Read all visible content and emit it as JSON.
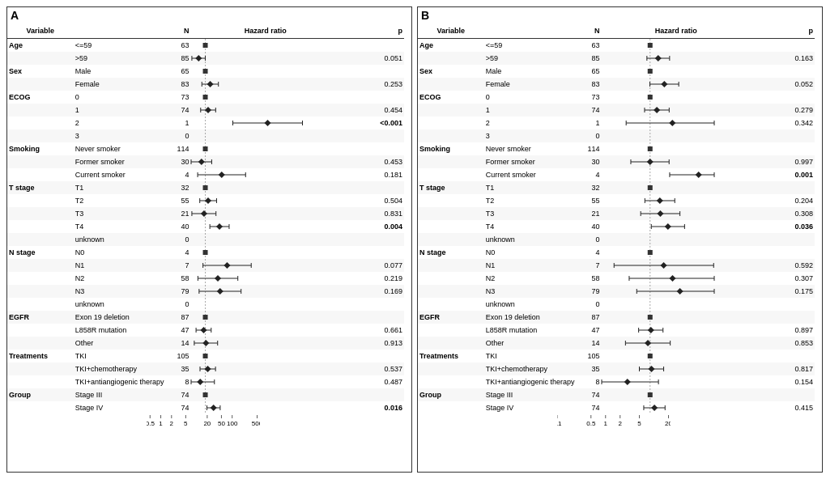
{
  "panels": {
    "A": {
      "label": "A",
      "rows": [
        {
          "variable": "Age",
          "subvar": "<=59",
          "n": "63",
          "hr_text": "Reference",
          "p": ""
        },
        {
          "variable": "",
          "subvar": ">59",
          "n": "85",
          "hr_text": "0.65 (0.42, 1.00)",
          "p": "0.051",
          "hr": 0.65,
          "lo": 0.42,
          "hi": 1.0
        },
        {
          "variable": "Sex",
          "subvar": "Male",
          "n": "65",
          "hr_text": "Reference",
          "p": ""
        },
        {
          "variable": "",
          "subvar": "Female",
          "n": "83",
          "hr_text": "1.37 (0.80, 2.33)",
          "p": "0.253",
          "hr": 1.37,
          "lo": 0.8,
          "hi": 2.33
        },
        {
          "variable": "ECOG",
          "subvar": "0",
          "n": "73",
          "hr_text": "Reference",
          "p": ""
        },
        {
          "variable": "",
          "subvar": "1",
          "n": "74",
          "hr_text": "1.20 (0.74, 1.95)",
          "p": "0.454",
          "hr": 1.2,
          "lo": 0.74,
          "hi": 1.95
        },
        {
          "variable": "",
          "subvar": "2",
          "n": "1",
          "hr_text": "55.65 (5.89, 526.12)",
          "p": "<0.001",
          "hr": 55.65,
          "lo": 5.89,
          "hi": 526.12,
          "extreme": true
        },
        {
          "variable": "",
          "subvar": "3",
          "n": "0",
          "hr_text": "",
          "p": ""
        },
        {
          "variable": "Smoking",
          "subvar": "Never smoker",
          "n": "114",
          "hr_text": "Reference",
          "p": ""
        },
        {
          "variable": "",
          "subvar": "Former smoker",
          "n": "30",
          "hr_text": "0.78 (0.40, 1.51)",
          "p": "0.453",
          "hr": 0.78,
          "lo": 0.4,
          "hi": 1.51
        },
        {
          "variable": "",
          "subvar": "Current smoker",
          "n": "4",
          "hr_text": "2.87 (0.61, 13.43)",
          "p": "0.181",
          "hr": 2.87,
          "lo": 0.61,
          "hi": 13.43
        },
        {
          "variable": "T stage",
          "subvar": "T1",
          "n": "32",
          "hr_text": "Reference",
          "p": ""
        },
        {
          "variable": "",
          "subvar": "T2",
          "n": "55",
          "hr_text": "1.20 (0.70, 2.07)",
          "p": "0.504",
          "hr": 1.2,
          "lo": 0.7,
          "hi": 2.07
        },
        {
          "variable": "",
          "subvar": "T3",
          "n": "21",
          "hr_text": "0.92 (0.42, 1.99)",
          "p": "0.831",
          "hr": 0.92,
          "lo": 0.42,
          "hi": 1.99
        },
        {
          "variable": "",
          "subvar": "T4",
          "n": "40",
          "hr_text": "2.49 (1.34, 4.65)",
          "p": "0.004",
          "hr": 2.49,
          "lo": 1.34,
          "hi": 4.65
        },
        {
          "variable": "",
          "subvar": "unknown",
          "n": "0",
          "hr_text": "",
          "p": ""
        },
        {
          "variable": "N stage",
          "subvar": "N0",
          "n": "4",
          "hr_text": "Reference",
          "p": ""
        },
        {
          "variable": "",
          "subvar": "N1",
          "n": "7",
          "hr_text": "4.07 (0.86, 19.32)",
          "p": "0.077",
          "hr": 4.07,
          "lo": 0.86,
          "hi": 19.32
        },
        {
          "variable": "",
          "subvar": "N2",
          "n": "58",
          "hr_text": "2.24 (0.62, 8.15)",
          "p": "0.219",
          "hr": 2.24,
          "lo": 0.62,
          "hi": 8.15
        },
        {
          "variable": "",
          "subvar": "N3",
          "n": "79",
          "hr_text": "2.59 (0.67, 10.05)",
          "p": "0.169",
          "hr": 2.59,
          "lo": 0.67,
          "hi": 10.05
        },
        {
          "variable": "",
          "subvar": "unknown",
          "n": "0",
          "hr_text": "",
          "p": ""
        },
        {
          "variable": "EGFR",
          "subvar": "Exon 19 deletion",
          "n": "87",
          "hr_text": "Reference",
          "p": ""
        },
        {
          "variable": "",
          "subvar": "L858R mutation",
          "n": "47",
          "hr_text": "0.90 (0.55, 1.46)",
          "p": "0.661",
          "hr": 0.9,
          "lo": 0.55,
          "hi": 1.46
        },
        {
          "variable": "",
          "subvar": "Other",
          "n": "14",
          "hr_text": "1.04 (0.49, 2.21)",
          "p": "0.913",
          "hr": 1.04,
          "lo": 0.49,
          "hi": 2.21
        },
        {
          "variable": "Treatments",
          "subvar": "TKI",
          "n": "105",
          "hr_text": "Reference",
          "p": ""
        },
        {
          "variable": "",
          "subvar": "TKI+chemotherapy",
          "n": "35",
          "hr_text": "1.17 (0.71, 1.93)",
          "p": "0.537",
          "hr": 1.17,
          "lo": 0.71,
          "hi": 1.93
        },
        {
          "variable": "",
          "subvar": "TKI+antiangiogenic therapy",
          "n": "8",
          "hr_text": "0.72 (0.29, 1.80)",
          "p": "0.487",
          "hr": 0.72,
          "lo": 0.29,
          "hi": 1.8
        },
        {
          "variable": "Group",
          "subvar": "Stage III",
          "n": "74",
          "hr_text": "Reference",
          "p": ""
        },
        {
          "variable": "",
          "subvar": "Stage IV",
          "n": "74",
          "hr_text": "1.70 (1.11, 2.61)",
          "p": "0.016",
          "hr": 1.7,
          "lo": 1.11,
          "hi": 2.61
        }
      ],
      "xaxis": "0.5  1   2    5  20  50 100500"
    },
    "B": {
      "label": "B",
      "rows": [
        {
          "variable": "Age",
          "subvar": "<=59",
          "n": "63",
          "hr_text": "Reference",
          "p": ""
        },
        {
          "variable": "",
          "subvar": ">59",
          "n": "85",
          "hr_text": "1.47 (0.86, 2.53)",
          "p": "0.163",
          "hr": 1.47,
          "lo": 0.86,
          "hi": 2.53
        },
        {
          "variable": "Sex",
          "subvar": "Male",
          "n": "65",
          "hr_text": "Reference",
          "p": ""
        },
        {
          "variable": "",
          "subvar": "Female",
          "n": "83",
          "hr_text": "1.97 (0.99, 3.91)",
          "p": "0.052",
          "hr": 1.97,
          "lo": 0.99,
          "hi": 3.91
        },
        {
          "variable": "ECOG",
          "subvar": "0",
          "n": "73",
          "hr_text": "Reference",
          "p": ""
        },
        {
          "variable": "",
          "subvar": "1",
          "n": "74",
          "hr_text": "1.38 (0.77, 2.48)",
          "p": "0.279",
          "hr": 1.38,
          "lo": 0.77,
          "hi": 2.48
        },
        {
          "variable": "",
          "subvar": "2",
          "n": "1",
          "hr_text": "2.89 (0.32, 25.72)",
          "p": "0.342",
          "hr": 2.89,
          "lo": 0.32,
          "hi": 25.72
        },
        {
          "variable": "",
          "subvar": "3",
          "n": "0",
          "hr_text": "",
          "p": ""
        },
        {
          "variable": "Smoking",
          "subvar": "Never smoker",
          "n": "114",
          "hr_text": "Reference",
          "p": ""
        },
        {
          "variable": "",
          "subvar": "Former smoker",
          "n": "30",
          "hr_text": "1.00 (0.40, 2.47)",
          "p": "0.997",
          "hr": 1.0,
          "lo": 0.4,
          "hi": 2.47
        },
        {
          "variable": "",
          "subvar": "Current smoker",
          "n": "4",
          "hr_text": "10.06 (2.54, 39.83)",
          "p": "0.001",
          "hr": 10.06,
          "lo": 2.54,
          "hi": 39.83
        },
        {
          "variable": "T stage",
          "subvar": "T1",
          "n": "32",
          "hr_text": "Reference",
          "p": ""
        },
        {
          "variable": "",
          "subvar": "T2",
          "n": "55",
          "hr_text": "1.59 (0.78, 3.24)",
          "p": "0.204",
          "hr": 1.59,
          "lo": 0.78,
          "hi": 3.24
        },
        {
          "variable": "",
          "subvar": "T3",
          "n": "21",
          "hr_text": "1.63 (0.64, 4.14)",
          "p": "0.308",
          "hr": 1.63,
          "lo": 0.64,
          "hi": 4.14
        },
        {
          "variable": "",
          "subvar": "T4",
          "n": "40",
          "hr_text": "2.34 (1.06, 5.16)",
          "p": "0.036",
          "hr": 2.34,
          "lo": 1.06,
          "hi": 5.16
        },
        {
          "variable": "",
          "subvar": "unknown",
          "n": "0",
          "hr_text": "",
          "p": ""
        },
        {
          "variable": "N stage",
          "subvar": "N0",
          "n": "4",
          "hr_text": "Reference",
          "p": ""
        },
        {
          "variable": "",
          "subvar": "N1",
          "n": "7",
          "hr_text": "1.91 (0.18, 20.57)",
          "p": "0.592",
          "hr": 1.91,
          "lo": 0.18,
          "hi": 20.57
        },
        {
          "variable": "",
          "subvar": "N2",
          "n": "58",
          "hr_text": "2.91 (0.37, 22.64)",
          "p": "0.307",
          "hr": 2.91,
          "lo": 0.37,
          "hi": 22.64
        },
        {
          "variable": "",
          "subvar": "N3",
          "n": "79",
          "hr_text": "4.14 (0.53, 32.39)",
          "p": "0.175",
          "hr": 4.14,
          "lo": 0.53,
          "hi": 32.39
        },
        {
          "variable": "",
          "subvar": "unknown",
          "n": "0",
          "hr_text": "",
          "p": ""
        },
        {
          "variable": "EGFR",
          "subvar": "Exon 19 deletion",
          "n": "87",
          "hr_text": "Reference",
          "p": ""
        },
        {
          "variable": "",
          "subvar": "L858R mutation",
          "n": "47",
          "hr_text": "1.04 (0.58, 1.85)",
          "p": "0.897",
          "hr": 1.04,
          "lo": 0.58,
          "hi": 1.85
        },
        {
          "variable": "",
          "subvar": "Other",
          "n": "14",
          "hr_text": "0.90 (0.31, 2.61)",
          "p": "0.853",
          "hr": 0.9,
          "lo": 0.31,
          "hi": 2.61
        },
        {
          "variable": "Treatments",
          "subvar": "TKI",
          "n": "105",
          "hr_text": "Reference",
          "p": ""
        },
        {
          "variable": "",
          "subvar": "TKI+chemotherapy",
          "n": "35",
          "hr_text": "1.07 (0.60, 1.91)",
          "p": "0.817",
          "hr": 1.07,
          "lo": 0.6,
          "hi": 1.91
        },
        {
          "variable": "",
          "subvar": "TKI+antiangiogenic therapy",
          "n": "8",
          "hr_text": "0.34 (0.08, 1.49)",
          "p": "0.154",
          "hr": 0.34,
          "lo": 0.08,
          "hi": 1.49
        },
        {
          "variable": "Group",
          "subvar": "Stage III",
          "n": "74",
          "hr_text": "Reference",
          "p": ""
        },
        {
          "variable": "",
          "subvar": "Stage IV",
          "n": "74",
          "hr_text": "1.23 (0.74, 2.04)",
          "p": "0.415",
          "hr": 1.23,
          "lo": 0.74,
          "hi": 2.04
        }
      ]
    }
  }
}
